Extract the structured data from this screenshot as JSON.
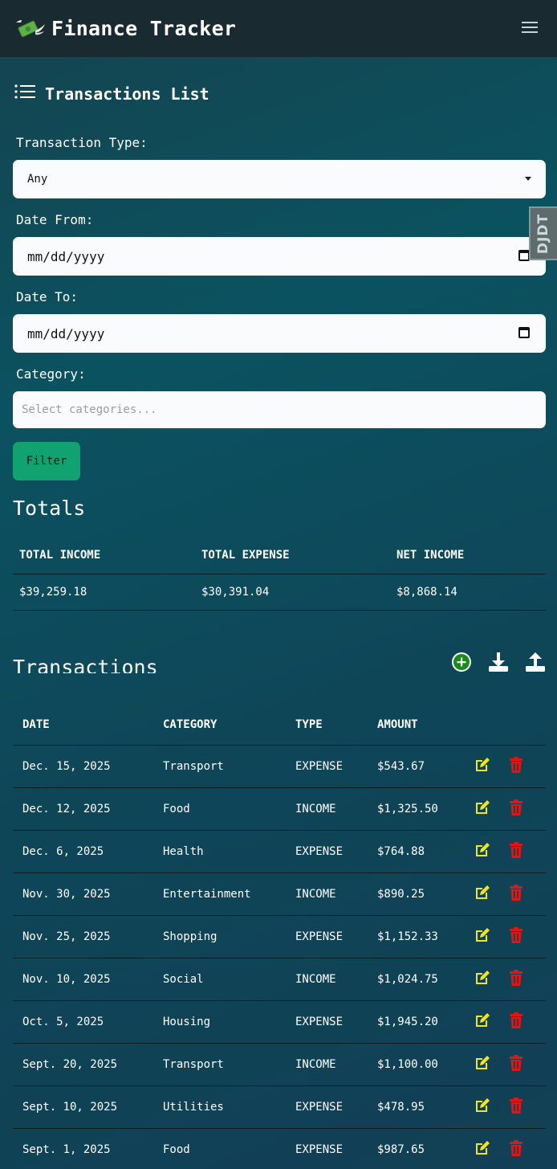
{
  "app": {
    "title": "Finance Tracker"
  },
  "filters": {
    "section_title": "Transactions List",
    "type_label": "Transaction Type:",
    "type_value": "Any",
    "date_from_label": "Date From:",
    "date_from_value": "mm/dd/yyyy",
    "date_to_label": "Date To:",
    "date_to_value": "mm/dd/yyyy",
    "category_label": "Category:",
    "category_placeholder": "Select categories...",
    "filter_button": "Filter"
  },
  "debug_toolbar": {
    "label": "DJDT"
  },
  "totals": {
    "title": "Totals",
    "headers": [
      "TOTAL INCOME",
      "TOTAL EXPENSE",
      "NET INCOME"
    ],
    "values": [
      "$39,259.18",
      "$30,391.04",
      "$8,868.14"
    ]
  },
  "transactions": {
    "title": "Transactions",
    "headers": [
      "DATE",
      "CATEGORY",
      "TYPE",
      "AMOUNT"
    ],
    "rows": [
      {
        "date": "Dec. 15, 2025",
        "category": "Transport",
        "type": "EXPENSE",
        "amount": "$543.67"
      },
      {
        "date": "Dec. 12, 2025",
        "category": "Food",
        "type": "INCOME",
        "amount": "$1,325.50"
      },
      {
        "date": "Dec. 6, 2025",
        "category": "Health",
        "type": "EXPENSE",
        "amount": "$764.88"
      },
      {
        "date": "Nov. 30, 2025",
        "category": "Entertainment",
        "type": "INCOME",
        "amount": "$890.25"
      },
      {
        "date": "Nov. 25, 2025",
        "category": "Shopping",
        "type": "EXPENSE",
        "amount": "$1,152.33"
      },
      {
        "date": "Nov. 10, 2025",
        "category": "Social",
        "type": "INCOME",
        "amount": "$1,024.75"
      },
      {
        "date": "Oct. 5, 2025",
        "category": "Housing",
        "type": "EXPENSE",
        "amount": "$1,945.20"
      },
      {
        "date": "Sept. 20, 2025",
        "category": "Transport",
        "type": "INCOME",
        "amount": "$1,100.00"
      },
      {
        "date": "Sept. 10, 2025",
        "category": "Utilities",
        "type": "EXPENSE",
        "amount": "$478.95"
      },
      {
        "date": "Sept. 1, 2025",
        "category": "Food",
        "type": "EXPENSE",
        "amount": "$987.65"
      }
    ]
  },
  "icons": {
    "add": "plus-circle-icon",
    "download": "download-icon",
    "upload": "upload-icon",
    "edit": "edit-icon",
    "delete": "trash-icon",
    "menu": "hamburger-icon",
    "list": "list-icon",
    "logo": "money-wings-icon"
  },
  "colors": {
    "accent_green": "#10a371",
    "edit_yellow": "#f2e61b",
    "delete_red": "#e01515",
    "add_green": "#1a8a1a",
    "navbar": "#1a2a31"
  }
}
